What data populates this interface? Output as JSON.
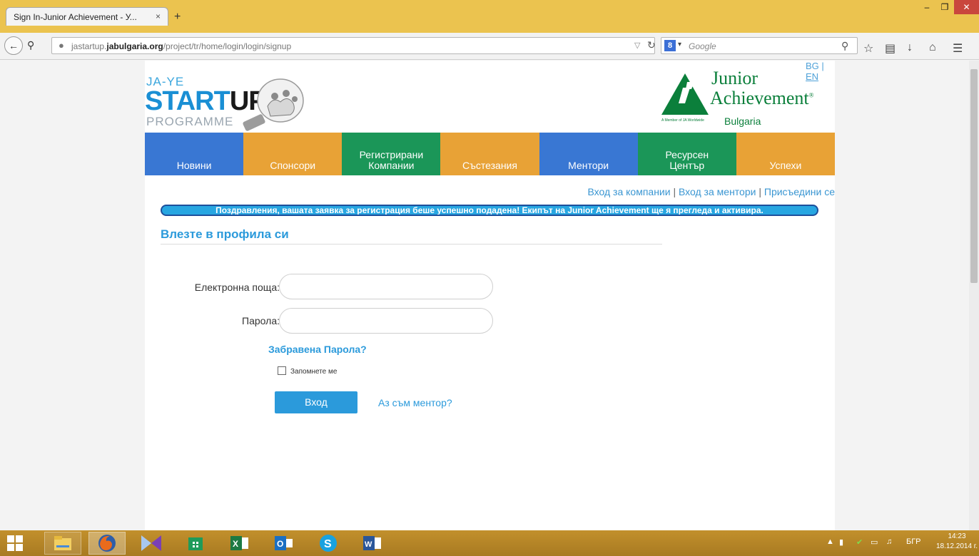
{
  "browser": {
    "tab_title": "Sign In-Junior Achievement - У...",
    "tab_close": "×",
    "new_tab": "+",
    "window_min": "–",
    "window_max": "❐",
    "window_close": "✕",
    "url_prefix": "jastartup.",
    "url_domain": "jabulgaria.org",
    "url_path": "/project/tr/home/login/login/signup",
    "search_placeholder": "Google",
    "search_engine_badge": "8"
  },
  "lang": {
    "bg": "BG",
    "sep": " | ",
    "en": "EN"
  },
  "logo_left": {
    "line1": "JA-YE",
    "line2a": "START",
    "line2b": "UP",
    "line3": "PROGRAMME"
  },
  "logo_right": {
    "junior": "Junior",
    "achievement": "Achievement",
    "reg": "®",
    "member": "A Member of JA Worldwide",
    "country": "Bulgaria"
  },
  "menu": [
    {
      "label": "Новини",
      "color": "blue"
    },
    {
      "label": "Спонсори",
      "color": "orange"
    },
    {
      "label": "Регистрирани\nКомпании",
      "color": "green"
    },
    {
      "label": "Състезания",
      "color": "orange"
    },
    {
      "label": "Ментори",
      "color": "blue"
    },
    {
      "label": "Ресурсен\nЦентър",
      "color": "green"
    },
    {
      "label": "Успехи",
      "color": "orange"
    }
  ],
  "top_links": {
    "company_login": "Вход за компании",
    "mentor_login": "Вход за ментори",
    "join": "Присъедини се",
    "sep": " | "
  },
  "notice": "Поздравления, вашата заявка за регистрация беше успешно подадена! Екипът на Junior Achievement ще я прегледа и активира.",
  "login": {
    "title": "Влезте в профила си",
    "email_label": "Електронна поща:",
    "password_label": "Парола:",
    "forgot": "Забравена Парола?",
    "remember": "Запомнете ме",
    "submit": "Вход",
    "mentor": "Аз съм ментор?"
  },
  "taskbar": {
    "lang_indicator": "БГР",
    "time": "14:23",
    "date": "18.12.2014 г."
  },
  "colors": {
    "blue": "#3977d3",
    "orange": "#e8a236",
    "green": "#1b9658",
    "accent": "#2b9adb"
  }
}
